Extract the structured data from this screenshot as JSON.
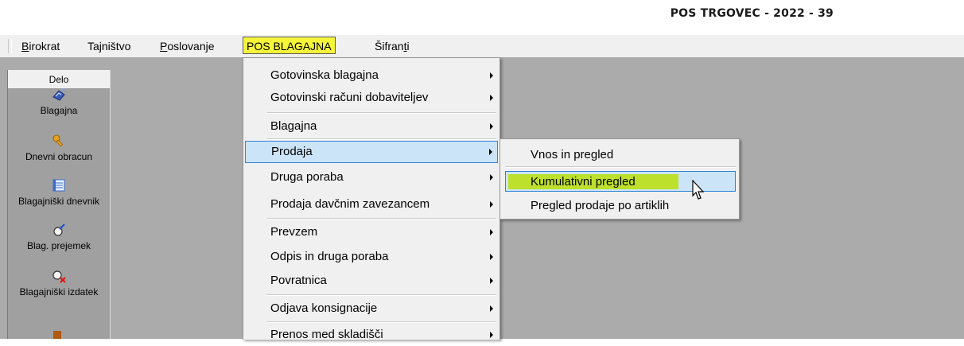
{
  "window": {
    "title": "POS TRGOVEC - 2022 - 39"
  },
  "menubar": {
    "items": [
      {
        "label": "Birokrat",
        "accel": "B",
        "rest": "irokrat",
        "active": false
      },
      {
        "label": "Tajništvo",
        "active": false
      },
      {
        "label": "Poslovanje",
        "accel": "P",
        "rest": "oslovanje",
        "active": false
      },
      {
        "label": "POS BLAGAJNA",
        "active": true
      },
      {
        "label": "Šifranti",
        "pre": "Šifran",
        "accel": "t",
        "post": "i",
        "active": false
      }
    ]
  },
  "sidebar": {
    "header": "Delo",
    "items": [
      {
        "label": "Blagajna",
        "icon": "cash-register-icon"
      },
      {
        "label": "Dnevni obracun",
        "icon": "key-icon"
      },
      {
        "label": "Blagajniški dnevnik",
        "icon": "ledger-icon"
      },
      {
        "label": "Blag. prejemek",
        "icon": "receipt-icon"
      },
      {
        "label": "Blagajniški izdatek",
        "icon": "expense-icon"
      }
    ]
  },
  "pos_menu": {
    "items": [
      {
        "label": "Gotovinska blagajna",
        "submenu": true
      },
      {
        "label": "Gotovinski računi dobaviteljev",
        "submenu": true
      },
      {
        "label": "Blagajna",
        "submenu": true
      },
      {
        "label": "Prodaja",
        "submenu": true,
        "highlighted": true
      },
      {
        "label": "Druga poraba",
        "submenu": true
      },
      {
        "label": "Prodaja davčnim zavezancem",
        "submenu": true
      },
      {
        "label": "Prevzem",
        "submenu": true
      },
      {
        "label": "Odpis in druga poraba",
        "submenu": true
      },
      {
        "label": "Povratnica",
        "submenu": true
      },
      {
        "label": "Odjava konsignacije",
        "submenu": true
      },
      {
        "label": "Prenos med skladišči",
        "submenu": true
      }
    ]
  },
  "prodaja_submenu": {
    "items": [
      {
        "label": "Vnos in pregled"
      },
      {
        "label": "Kumulativni pregled",
        "highlighted": true
      },
      {
        "label": "Pregled prodaje po artiklih"
      }
    ]
  },
  "colors": {
    "highlight_yellow": "#f5f53a",
    "marker_green": "#bde02c",
    "menu_hover": "#cce4f7",
    "menu_hover_border": "#2c84d8",
    "workspace": "#ababab"
  }
}
